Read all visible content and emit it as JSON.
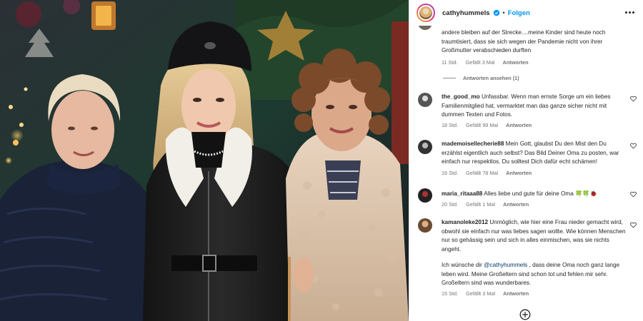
{
  "header": {
    "username": "cathyhummels",
    "separator": "•",
    "follow_label": "Folgen"
  },
  "comments": [
    {
      "text": "andere bleiben auf der Strecke....meine Kinder sind heute noch traumtisiert, dass sie sich wegen der Pandemie nicht von ihrer Großmutter verabschieden durften",
      "time": "11 Std.",
      "likes": "Gefällt 3 Mal",
      "reply": "Antworten"
    },
    {
      "user": "the_good_mo",
      "text": "Unfassbar. Wenn man ernste Sorge um ein liebes Familienmitglied hat, vermarktet man das ganze sicher nicht mit dummen Texten und Fotos.",
      "time": "18 Std.",
      "likes": "Gefällt 99 Mal",
      "reply": "Antworten"
    },
    {
      "user": "mademoisellecherie88",
      "text": "Mein Gott, glaubst Du den Mist den Du erzählst eigentlich auch selbst? Das Bild Deiner Oma zu posten, war einfach nur respektlos. Du solltest Dich dafür echt schämen!",
      "time": "16 Std.",
      "likes": "Gefällt 78 Mal",
      "reply": "Antworten"
    },
    {
      "user": "maria_ritaaa88",
      "text": "Alles liebe und gute für deine Oma 🍀🍀🐞",
      "time": "20 Std.",
      "likes": "Gefällt 1 Mal",
      "reply": "Antworten"
    },
    {
      "user": "kamanoleke2012",
      "text": "Unmöglich, wie hier eine Frau nieder gemacht wird, obwohl sie einfach nur was liebes sagen wollte. Wie können Menschen nur so gehässig sein und sich in alles einmischen, was sie nichts angeht.",
      "text2_before": "Ich wünsche dir ",
      "text2_mention": "@cathyhummels",
      "text2_after": " , dass deine Oma noch ganz lange leben wird. Meine Großeltern sind schon tot und fehlen mir sehr. Großeltern sind was wunderbares.",
      "time": "15 Std.",
      "likes": "Gefällt 3 Mal",
      "reply": "Antworten"
    }
  ],
  "view_replies_label": "Antworten ansehen (1)",
  "icons": {
    "verified": "verified-badge-icon",
    "more": "more-options-icon",
    "heart": "heart-icon",
    "add": "add-circle-icon"
  },
  "colors": {
    "accent": "#0095f6",
    "verified": "#0095f6",
    "meta": "#737373",
    "text": "#262626"
  }
}
